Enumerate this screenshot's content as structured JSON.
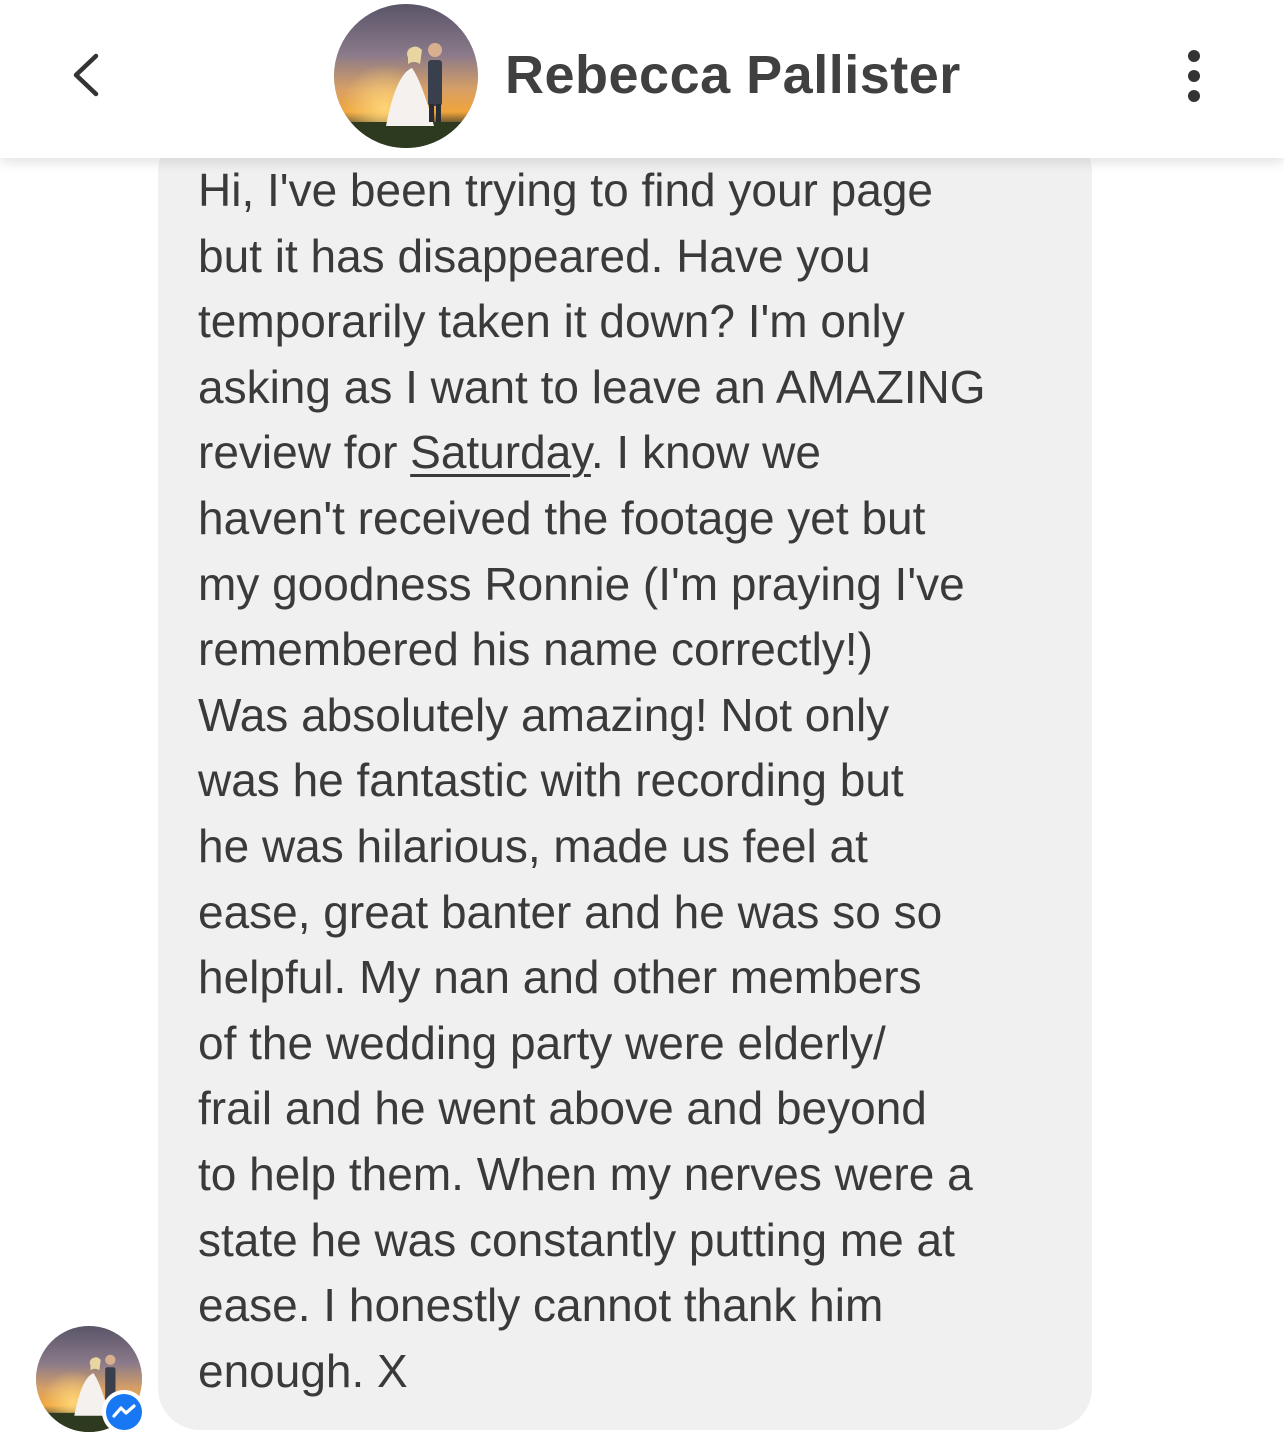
{
  "header": {
    "contact_name": "Rebecca Pallister",
    "back_icon": "chevron-left-icon",
    "more_icon": "vertical-ellipsis-icon"
  },
  "message": {
    "lines_before_link": [
      "Hi, I've been trying to find your page",
      "but it has disappeared. Have you",
      "temporarily taken it down? I'm only",
      "asking as I want to leave an AMAZING"
    ],
    "line_prefix": "review for ",
    "link_text": "Saturday",
    "line_suffix": ". I know we",
    "lines_after_link": [
      "haven't received the footage yet but",
      "my goodness Ronnie (I'm praying I've",
      "remembered his name correctly!)",
      "Was absolutely amazing! Not only",
      "was he fantastic with recording but",
      "he was hilarious, made us feel at",
      "ease, great banter and he was so so",
      "helpful. My nan and other members",
      "of the wedding party were elderly/",
      "frail and he went above and beyond",
      "to help them. When my nerves were a",
      "state he was constantly putting me at",
      "ease. I honestly cannot thank him",
      "enough. X"
    ]
  },
  "sender": {
    "avatar": "wedding-photo-avatar",
    "badge_icon": "messenger-icon"
  },
  "colors": {
    "bubble": "#f0f0f0",
    "messenger_blue": "#1877f2",
    "name_text": "#404040"
  }
}
